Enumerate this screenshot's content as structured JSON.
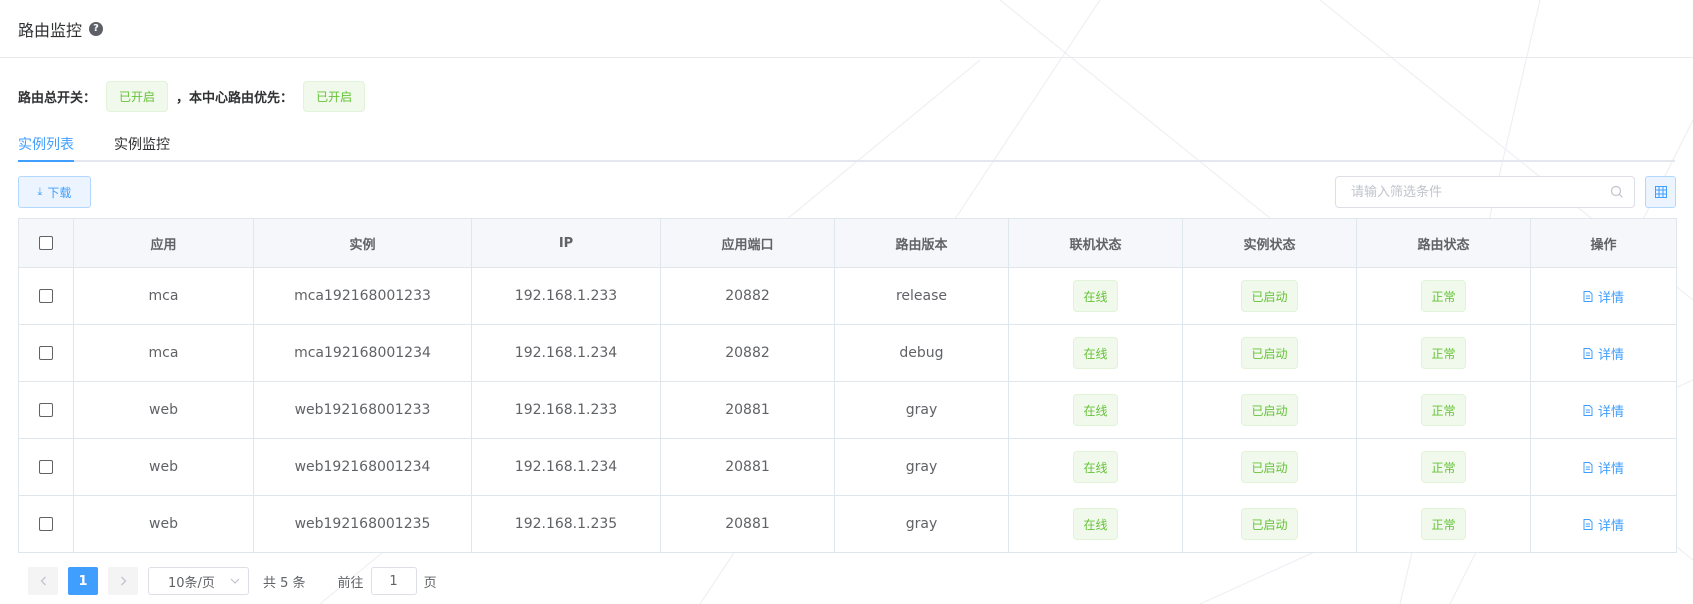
{
  "header": {
    "title": "路由监控",
    "help_icon": "question-circle-icon"
  },
  "switches": {
    "global_label": "路由总开关：",
    "global_status": "已开启",
    "separator": "，",
    "center_label": "本中心路由优先：",
    "center_status": "已开启"
  },
  "tabs": [
    {
      "label": "实例列表",
      "active": true
    },
    {
      "label": "实例监控",
      "active": false
    }
  ],
  "toolbar": {
    "download_label": "下载",
    "download_icon": "download-icon",
    "search_placeholder": "请输入筛选条件",
    "search_value": "",
    "columns_icon": "table-columns-icon"
  },
  "table": {
    "columns": [
      "应用",
      "实例",
      "IP",
      "应用端口",
      "路由版本",
      "联机状态",
      "实例状态",
      "路由状态",
      "操作"
    ],
    "rows": [
      {
        "app": "mca",
        "instance": "mca192168001233",
        "ip": "192.168.1.233",
        "port": "20882",
        "version": "release",
        "online": "在线",
        "instance_status": "已启动",
        "route_status": "正常",
        "action": "详情"
      },
      {
        "app": "mca",
        "instance": "mca192168001234",
        "ip": "192.168.1.234",
        "port": "20882",
        "version": "debug",
        "online": "在线",
        "instance_status": "已启动",
        "route_status": "正常",
        "action": "详情"
      },
      {
        "app": "web",
        "instance": "web192168001233",
        "ip": "192.168.1.233",
        "port": "20881",
        "version": "gray",
        "online": "在线",
        "instance_status": "已启动",
        "route_status": "正常",
        "action": "详情"
      },
      {
        "app": "web",
        "instance": "web192168001234",
        "ip": "192.168.1.234",
        "port": "20881",
        "version": "gray",
        "online": "在线",
        "instance_status": "已启动",
        "route_status": "正常",
        "action": "详情"
      },
      {
        "app": "web",
        "instance": "web192168001235",
        "ip": "192.168.1.235",
        "port": "20881",
        "version": "gray",
        "online": "在线",
        "instance_status": "已启动",
        "route_status": "正常",
        "action": "详情"
      }
    ],
    "detail_icon": "document-icon"
  },
  "pagination": {
    "current_page": "1",
    "page_size": "10条/页",
    "total": "共 5 条",
    "goto_prefix": "前往",
    "goto_value": "1",
    "goto_suffix": "页"
  },
  "colors": {
    "primary": "#409eff",
    "success": "#67c23a",
    "success_bg": "#f0f9eb"
  }
}
